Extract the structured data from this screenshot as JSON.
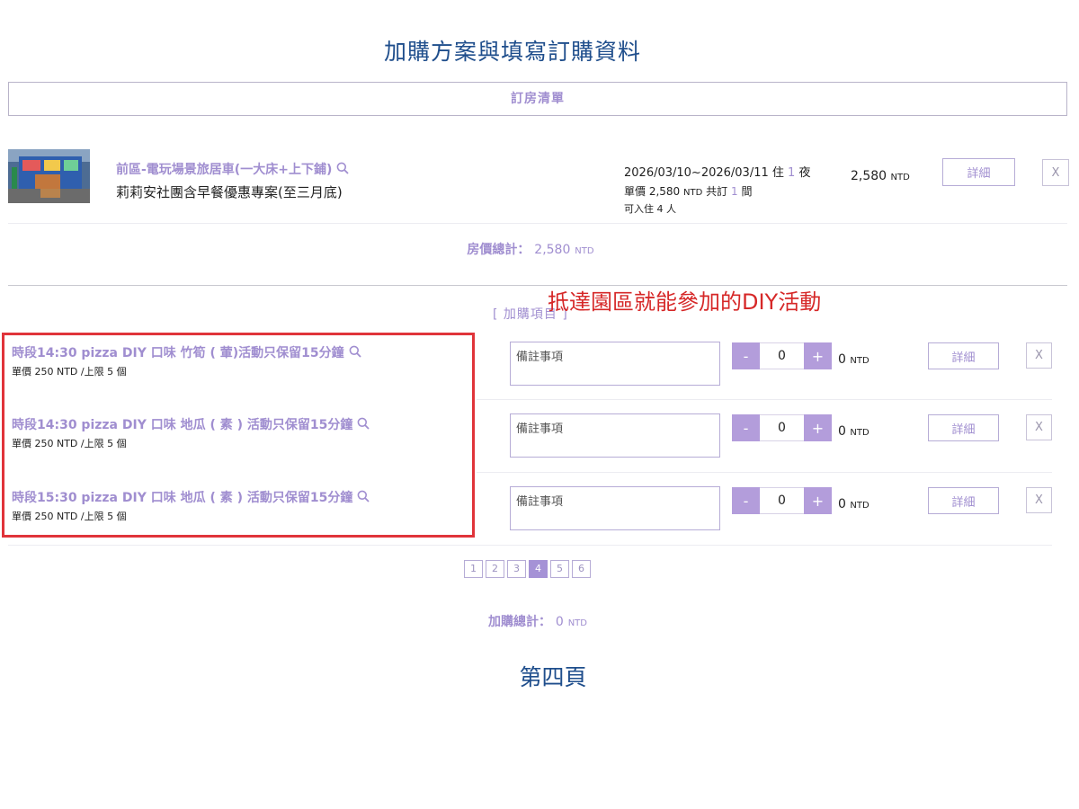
{
  "page_title": "加購方案與填寫訂購資料",
  "booking_list": {
    "header": "訂房清單",
    "room": {
      "name": "前區-電玩場景旅居車(一大床+上下鋪)",
      "plan": "莉莉安社團含早餐優惠專案(至三月底)",
      "dates": "2026/03/10~2026/03/11 住",
      "nights": "1",
      "nights_unit": "夜",
      "unit_price_label": "單價 2,580",
      "booked_label": "共訂",
      "rooms": "1",
      "rooms_unit": "間",
      "capacity": "可入住 4 人",
      "total": "2,580",
      "detail_label": "詳細",
      "remove_label": "X"
    },
    "room_total_label": "房價總計：",
    "room_total_value": "2,580",
    "currency": "NTD"
  },
  "annotation": "抵達園區就能參加的DIY活動",
  "addons": {
    "title": "[ 加購項目 ]",
    "items": [
      {
        "name": "時段14:30 pizza DIY 口味 竹筍 ( 葷)活動只保留15分鐘",
        "sub": "單價 250 NTD /上限 5 個",
        "note_placeholder": "備註事項",
        "minus": "-",
        "qty": "0",
        "plus": "+",
        "total": "0",
        "detail_label": "詳細",
        "remove_label": "X"
      },
      {
        "name": "時段14:30 pizza DIY 口味 地瓜 ( 素 ) 活動只保留15分鐘",
        "sub": "單價 250 NTD /上限 5 個",
        "note_placeholder": "備註事項",
        "minus": "-",
        "qty": "0",
        "plus": "+",
        "total": "0",
        "detail_label": "詳細",
        "remove_label": "X"
      },
      {
        "name": "時段15:30 pizza DIY 口味 地瓜 ( 素 ) 活動只保留15分鐘",
        "sub": "單價 250 NTD /上限 5 個",
        "note_placeholder": "備註事項",
        "minus": "-",
        "qty": "0",
        "plus": "+",
        "total": "0",
        "detail_label": "詳細",
        "remove_label": "X"
      }
    ],
    "pagination": [
      "1",
      "2",
      "3",
      "4",
      "5",
      "6"
    ],
    "current_page": "4",
    "total_label": "加購總計：",
    "total_value": "0"
  },
  "page_caption": "第四頁",
  "colors": {
    "accent": "#a08ed0",
    "title_blue": "#1f4e8c",
    "annotation_red": "#d62828",
    "button_purple": "#b39ddb"
  },
  "icons": {
    "search": "search-icon"
  }
}
